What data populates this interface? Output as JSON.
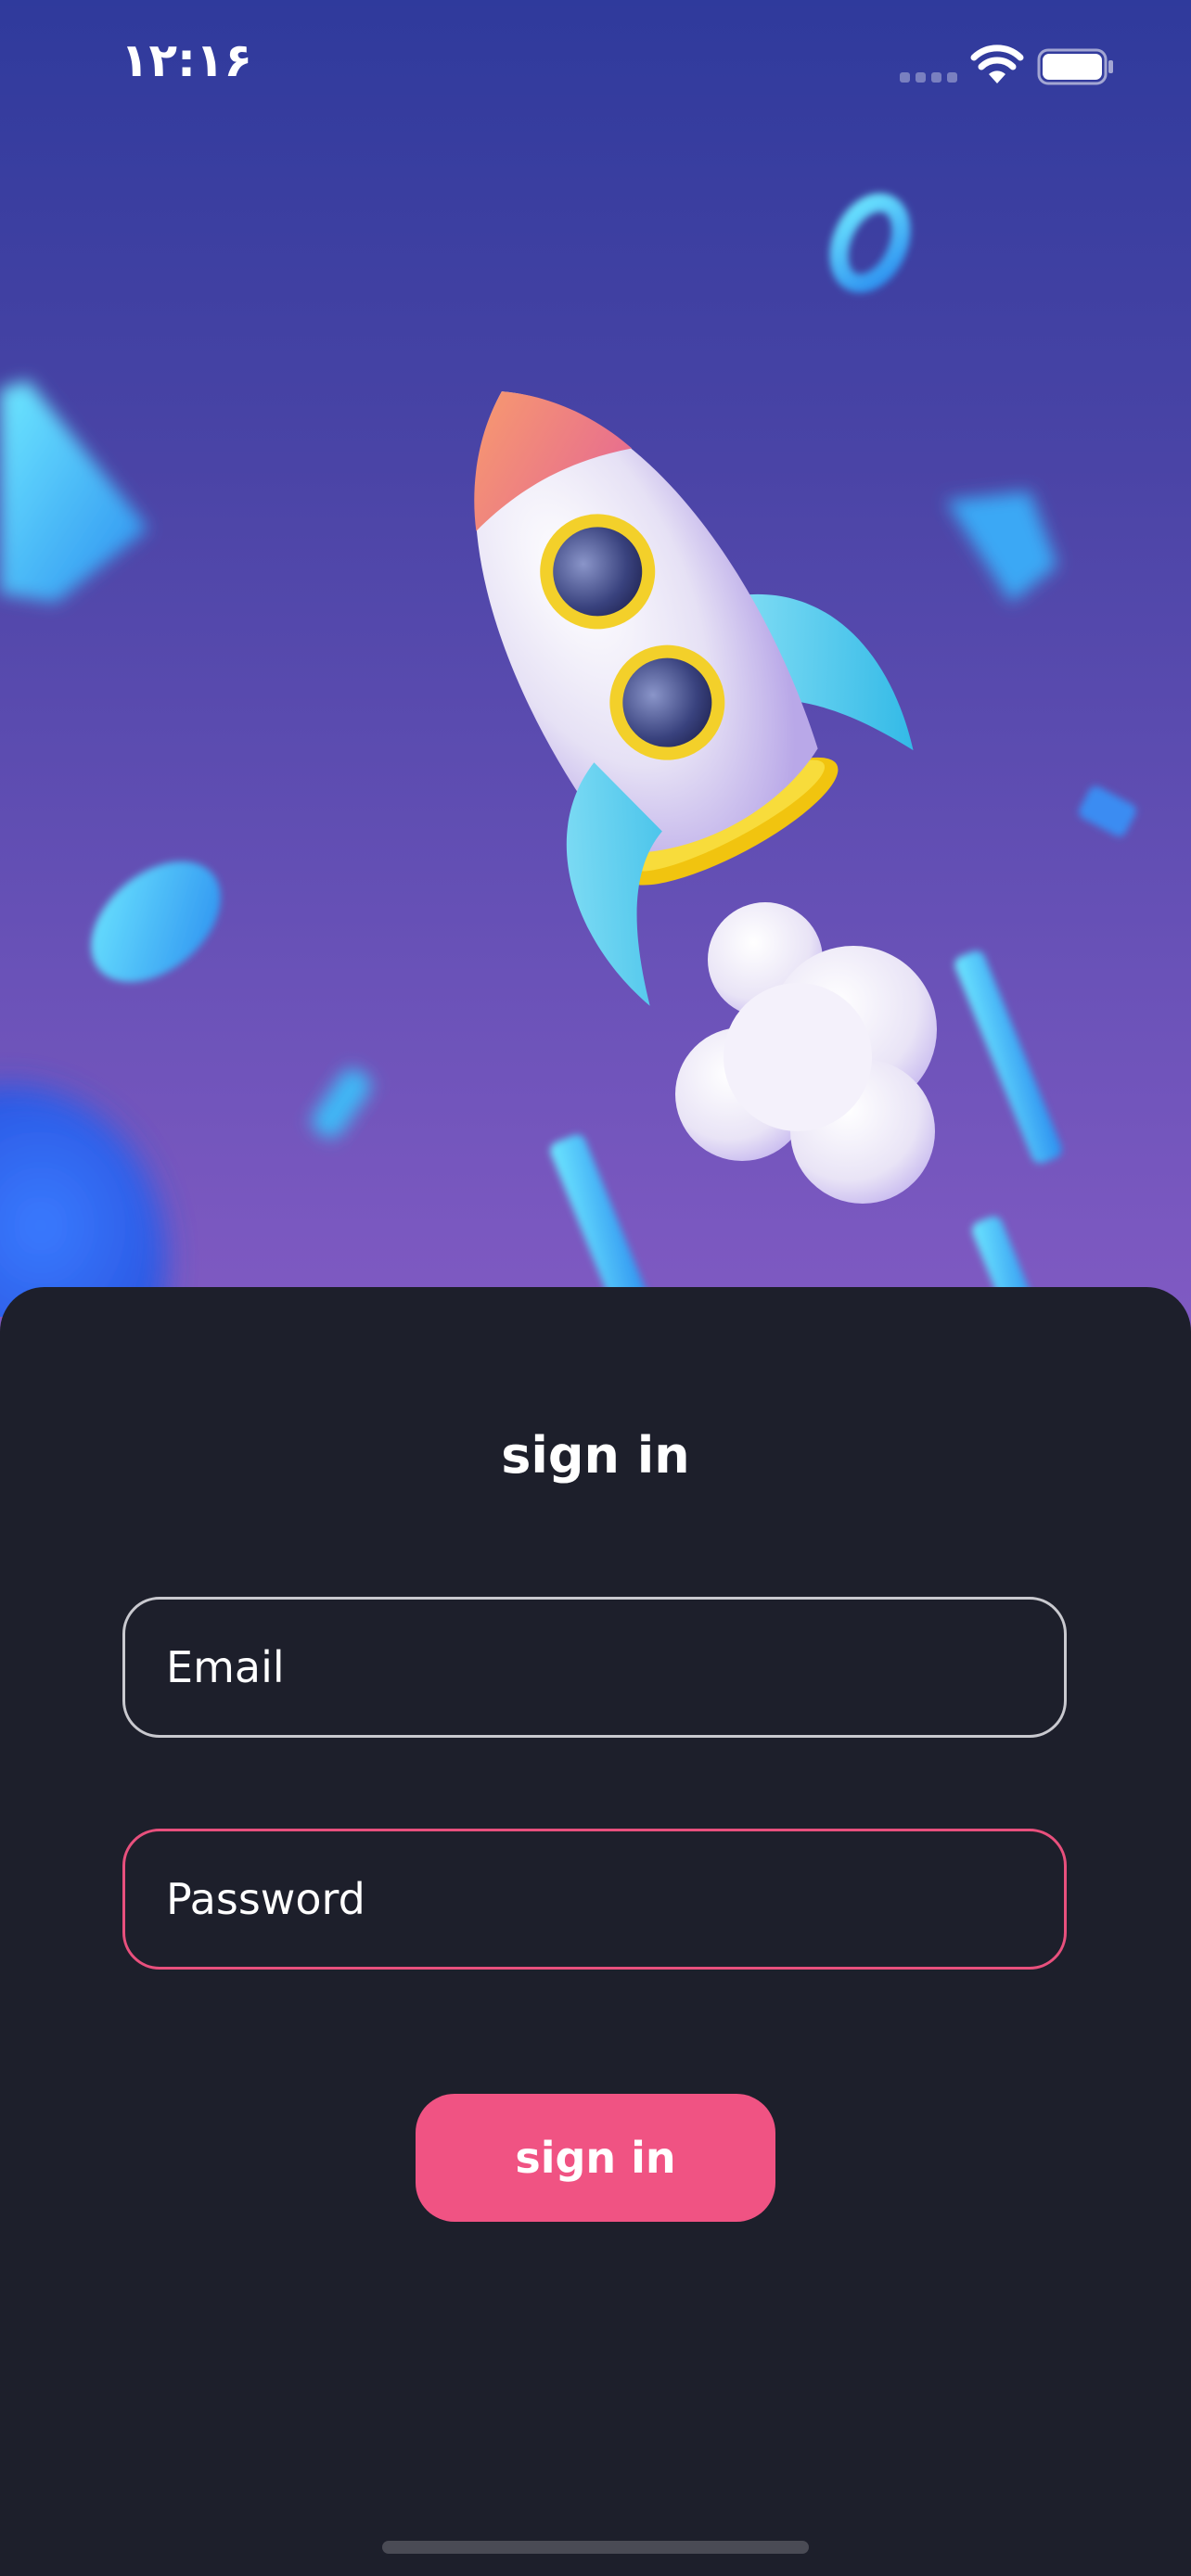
{
  "status_bar": {
    "time": "۱۲:۱۶",
    "signal_icon": "signal-bars-icon",
    "wifi_icon": "wifi-icon",
    "battery_icon": "battery-full-icon"
  },
  "hero": {
    "illustration": "rocket-launch-illustration"
  },
  "sign_in": {
    "title": "sign in",
    "email_placeholder": "Email",
    "password_placeholder": "Password",
    "button_label": "sign in"
  },
  "colors": {
    "sheet_background": "#1d1f2b",
    "accent": "#f05383",
    "email_border": "#c9c9cf",
    "password_border": "#e8507d",
    "gradient_top": "#2f3a9c",
    "gradient_bottom": "#9d66cf"
  }
}
